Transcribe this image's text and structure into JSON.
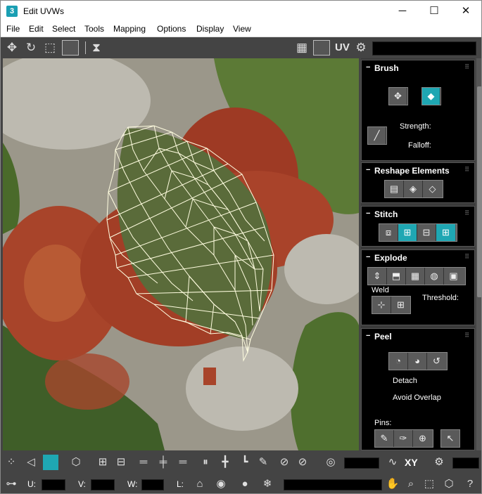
{
  "window": {
    "title": "Edit UVWs",
    "app_icon": "3",
    "controls": {
      "minimize": "─",
      "maximize": "☐",
      "close": "✕"
    }
  },
  "menu": [
    "File",
    "Edit",
    "Select",
    "Tools",
    "Mapping",
    "Options",
    "Display",
    "View"
  ],
  "toolbar": {
    "uv_label": "UV"
  },
  "panel": {
    "brush": {
      "title": "Brush",
      "strength_label": "Strength:",
      "falloff_label": "Falloff:"
    },
    "reshape": {
      "title": "Reshape Elements"
    },
    "stitch": {
      "title": "Stitch"
    },
    "explode": {
      "title": "Explode",
      "weld_label": "Weld",
      "threshold_label": "Threshold:"
    },
    "peel": {
      "title": "Peel",
      "detach_label": "Detach",
      "avoid_overlap_label": "Avoid Overlap",
      "pins_label": "Pins:"
    }
  },
  "bottom": {
    "xy_label": "XY",
    "u_label": "U:",
    "v_label": "V:",
    "w_label": "W:",
    "l_label": "L:"
  },
  "colors": {
    "accent": "#1fa7b3",
    "panel_bg": "#000000",
    "toolbar_bg": "#444444",
    "mesh": "#fffde0"
  }
}
